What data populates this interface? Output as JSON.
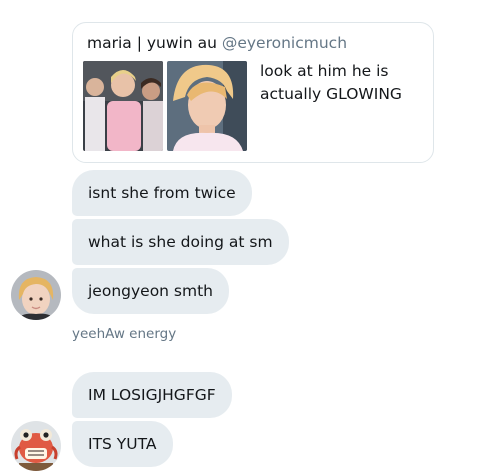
{
  "quoted_tweet": {
    "author_name": "maria | yuwin au",
    "handle": "@eyeronicmuch",
    "text": "look at him he is actually GLOWING",
    "images": [
      "concert-photo",
      "closeup-photo"
    ]
  },
  "messages": [
    {
      "id": "m1",
      "text": "isnt she from twice"
    },
    {
      "id": "m2",
      "text": "what is she doing at sm"
    },
    {
      "id": "m3",
      "text": "jeongyeon smth"
    },
    {
      "id": "m4",
      "text": "IM LOSIGJHGFGF"
    },
    {
      "id": "m5",
      "text": "ITS YUTA"
    }
  ],
  "sender_name": "yeehAw energy",
  "colors": {
    "bubble_bg": "#e6ecf0",
    "secondary_text": "#657786",
    "card_border": "#dfe6ea"
  }
}
